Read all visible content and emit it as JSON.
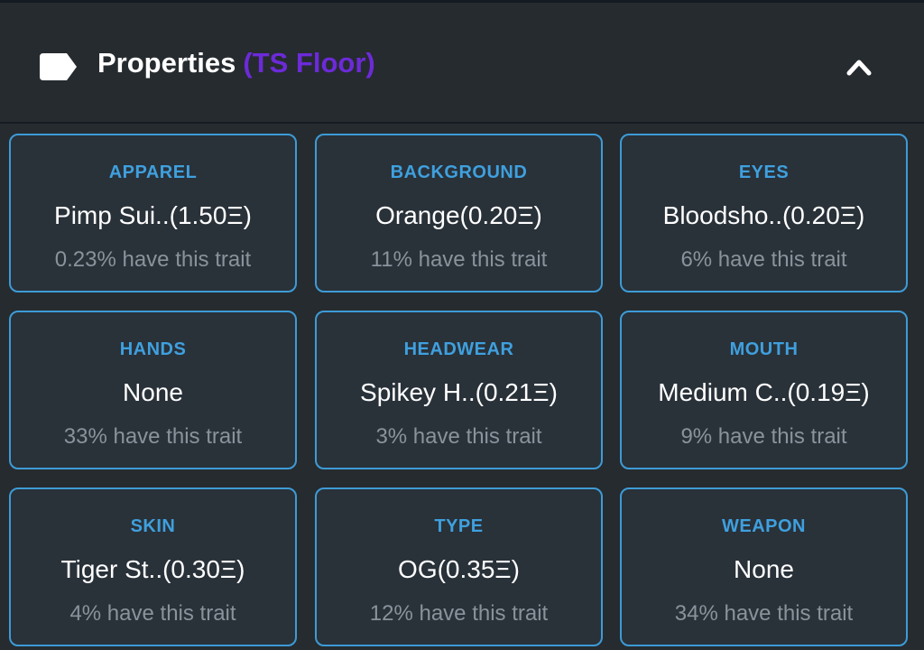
{
  "header": {
    "title": "Properties",
    "floor_label": "(TS Floor)",
    "tag_icon": "tag-icon",
    "collapse_icon": "chevron-up-icon"
  },
  "colors": {
    "card_border": "#3d9bd6",
    "trait_type": "#3fa0de",
    "floor_label": "#6c2ad8",
    "panel_bg": "#262b2f"
  },
  "traits": [
    {
      "type": "APPAREL",
      "value": "Pimp Sui..(1.50Ξ)",
      "rarity": "0.23% have this trait"
    },
    {
      "type": "BACKGROUND",
      "value": "Orange(0.20Ξ)",
      "rarity": "11% have this trait"
    },
    {
      "type": "EYES",
      "value": "Bloodsho..(0.20Ξ)",
      "rarity": "6% have this trait"
    },
    {
      "type": "HANDS",
      "value": "None",
      "rarity": "33% have this trait"
    },
    {
      "type": "HEADWEAR",
      "value": "Spikey H..(0.21Ξ)",
      "rarity": "3% have this trait"
    },
    {
      "type": "MOUTH",
      "value": "Medium C..(0.19Ξ)",
      "rarity": "9% have this trait"
    },
    {
      "type": "SKIN",
      "value": "Tiger St..(0.30Ξ)",
      "rarity": "4% have this trait"
    },
    {
      "type": "TYPE",
      "value": "OG(0.35Ξ)",
      "rarity": "12% have this trait"
    },
    {
      "type": "WEAPON",
      "value": "None",
      "rarity": "34% have this trait"
    }
  ]
}
